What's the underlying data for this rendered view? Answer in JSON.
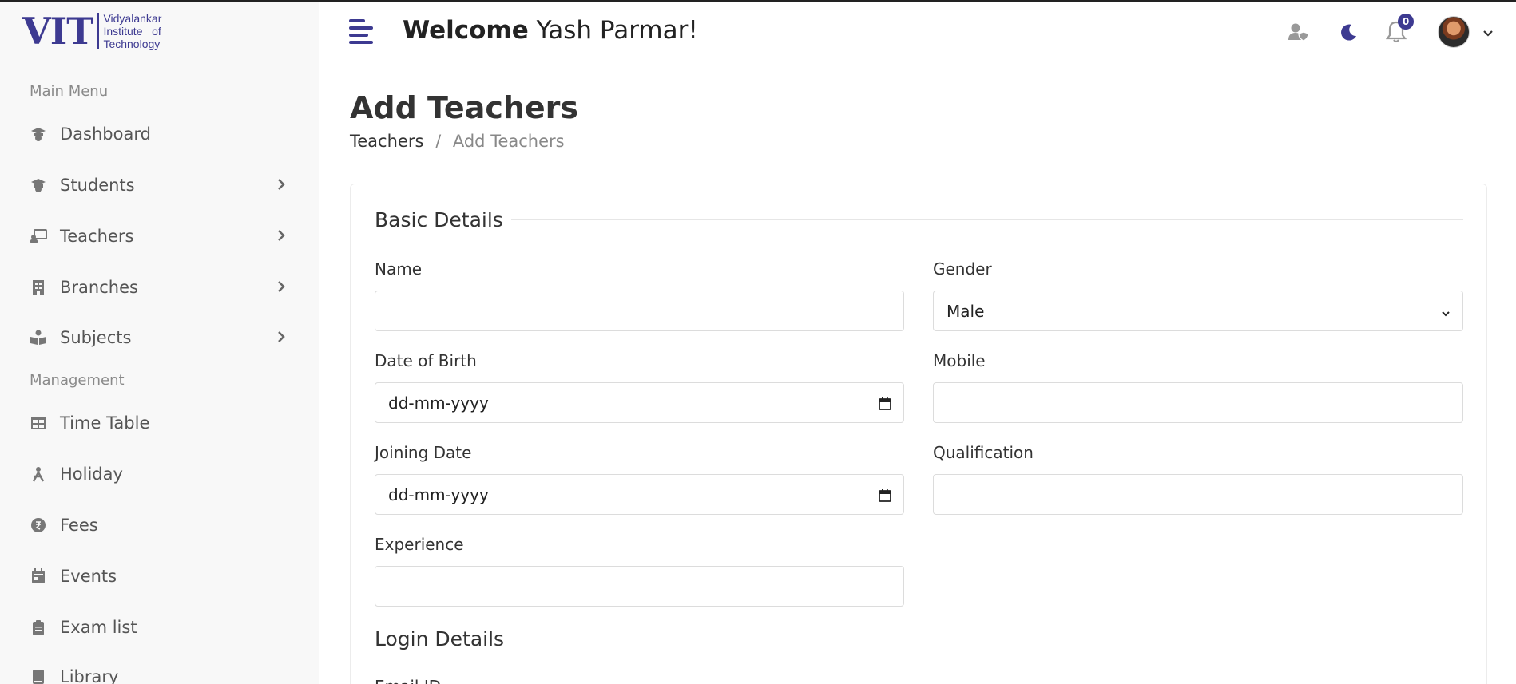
{
  "logo": {
    "mark": "VIT",
    "line1": "Vidyalankar",
    "line2": "Institute   of",
    "line3": "Technology"
  },
  "sidebar": {
    "main_menu_title": "Main Menu",
    "management_title": "Management",
    "items": [
      {
        "label": "Dashboard",
        "icon": "graduation-cap-icon"
      },
      {
        "label": "Students",
        "icon": "graduation-cap-icon"
      },
      {
        "label": "Teachers",
        "icon": "chalkboard-teacher-icon"
      },
      {
        "label": "Branches",
        "icon": "building-icon"
      },
      {
        "label": "Subjects",
        "icon": "book-reader-icon"
      },
      {
        "label": "Time Table",
        "icon": "table-icon"
      },
      {
        "label": "Holiday",
        "icon": "holiday-icon"
      },
      {
        "label": "Fees",
        "icon": "money-icon"
      },
      {
        "label": "Events",
        "icon": "calendar-icon"
      },
      {
        "label": "Exam list",
        "icon": "clipboard-icon"
      },
      {
        "label": "Library",
        "icon": "book-icon"
      }
    ]
  },
  "header": {
    "welcome_bold": "Welcome",
    "user_name": "Yash Parmar!",
    "notification_count": "0",
    "accent_color": "#3d3a91"
  },
  "page": {
    "title": "Add Teachers",
    "breadcrumb_home": "Teachers",
    "breadcrumb_sep": "/",
    "breadcrumb_current": "Add Teachers"
  },
  "form": {
    "basic_details_title": "Basic Details",
    "login_details_title": "Login Details",
    "name_label": "Name",
    "name_value": "",
    "gender_label": "Gender",
    "gender_value": "Male",
    "dob_label": "Date of Birth",
    "dob_value": "dd-mm-yyyy",
    "mobile_label": "Mobile",
    "mobile_value": "",
    "joining_label": "Joining Date",
    "joining_value": "dd-mm-yyyy",
    "qualification_label": "Qualification",
    "qualification_value": "",
    "experience_label": "Experience",
    "experience_value": "",
    "email_label": "Email ID"
  }
}
